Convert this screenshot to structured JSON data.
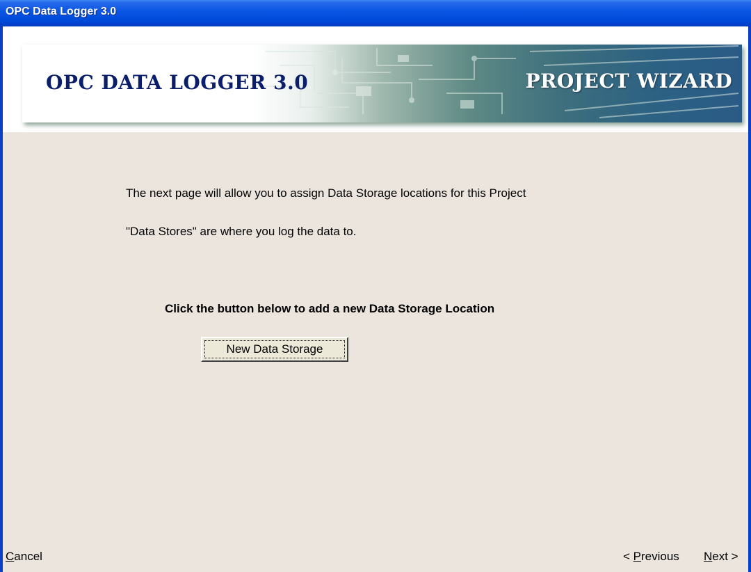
{
  "window": {
    "title": "OPC Data Logger 3.0"
  },
  "banner": {
    "left_text": "OPC DATA LOGGER 3.0",
    "right_text": "PROJECT WIZARD"
  },
  "content": {
    "line1": "The next page will allow you to assign Data Storage locations for this Project",
    "line2": "\"Data Stores\" are where you log the data to.",
    "instruction": "Click the button below to add a new Data Storage Location",
    "new_button_label": "New Data Storage"
  },
  "footer": {
    "cancel_accel": "C",
    "cancel_rest": "ancel",
    "previous_prefix": "< ",
    "previous_accel": "P",
    "previous_rest": "revious",
    "next_accel": "N",
    "next_rest": "ext >"
  }
}
